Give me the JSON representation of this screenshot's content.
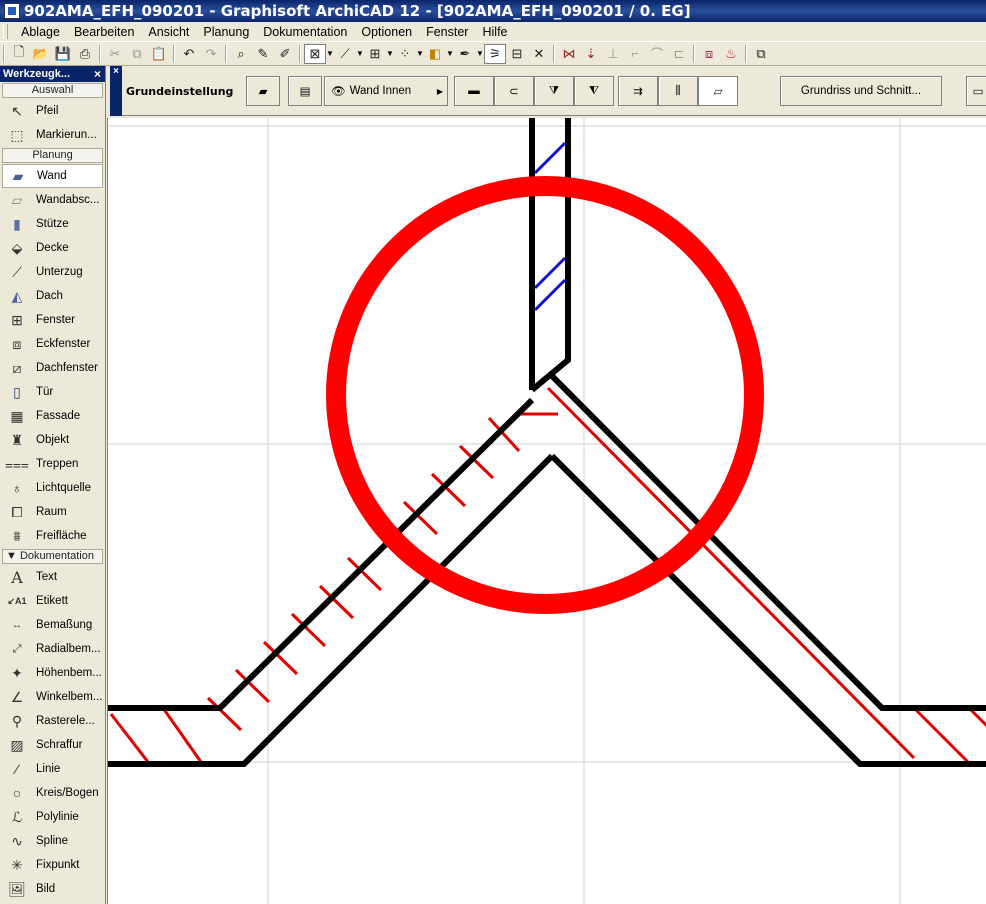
{
  "window": {
    "title": "902AMA_EFH_090201 - Graphisoft ArchiCAD 12 - [902AMA_EFH_090201 / 0. EG]"
  },
  "menubar": {
    "items": [
      "Ablage",
      "Bearbeiten",
      "Ansicht",
      "Planung",
      "Dokumentation",
      "Optionen",
      "Fenster",
      "Hilfe"
    ]
  },
  "toolbox": {
    "title": "Werkzeugk...",
    "close": "×",
    "sections": {
      "auswahl": "Auswahl",
      "planung": "Planung",
      "dokumentation": "Dokumentation"
    },
    "auswahl_tools": [
      {
        "label": "Pfeil",
        "icon": "arrow-pointer-icon"
      },
      {
        "label": "Markierun...",
        "icon": "marquee-icon"
      }
    ],
    "planung_tools": [
      {
        "label": "Wand",
        "icon": "wall-icon"
      },
      {
        "label": "Wandabsc...",
        "icon": "wall-end-icon"
      },
      {
        "label": "Stütze",
        "icon": "column-icon"
      },
      {
        "label": "Decke",
        "icon": "slab-icon"
      },
      {
        "label": "Unterzug",
        "icon": "beam-icon"
      },
      {
        "label": "Dach",
        "icon": "roof-icon"
      },
      {
        "label": "Fenster",
        "icon": "window-icon"
      },
      {
        "label": "Eckfenster",
        "icon": "corner-window-icon"
      },
      {
        "label": "Dachfenster",
        "icon": "skylight-icon"
      },
      {
        "label": "Tür",
        "icon": "door-icon"
      },
      {
        "label": "Fassade",
        "icon": "curtain-wall-icon"
      },
      {
        "label": "Objekt",
        "icon": "object-chair-icon"
      },
      {
        "label": "Treppen",
        "icon": "stair-icon"
      },
      {
        "label": "Lichtquelle",
        "icon": "lamp-icon"
      },
      {
        "label": "Raum",
        "icon": "zone-icon"
      },
      {
        "label": "Freifläche",
        "icon": "mesh-icon"
      }
    ],
    "doku_tools": [
      {
        "label": "Text",
        "icon": "text-icon"
      },
      {
        "label": "Etikett",
        "icon": "label-icon"
      },
      {
        "label": "Bemaßung",
        "icon": "dimension-icon"
      },
      {
        "label": "Radialbem...",
        "icon": "radial-dimension-icon"
      },
      {
        "label": "Höhenbem...",
        "icon": "level-dimension-icon"
      },
      {
        "label": "Winkelbem...",
        "icon": "angle-dimension-icon"
      },
      {
        "label": "Rasterele...",
        "icon": "grid-element-icon"
      },
      {
        "label": "Schraffur",
        "icon": "fill-hatch-icon"
      },
      {
        "label": "Linie",
        "icon": "line-icon"
      },
      {
        "label": "Kreis/Bogen",
        "icon": "circle-arc-icon"
      },
      {
        "label": "Polylinie",
        "icon": "polyline-icon"
      },
      {
        "label": "Spline",
        "icon": "spline-icon"
      },
      {
        "label": "Fixpunkt",
        "icon": "hotspot-icon"
      },
      {
        "label": "Bild",
        "icon": "picture-icon"
      }
    ]
  },
  "infobox": {
    "close": "×",
    "label": "Grundeinstellung",
    "layer_button": "Wand Innen",
    "section_button": "Grundriss und Schnitt..."
  }
}
